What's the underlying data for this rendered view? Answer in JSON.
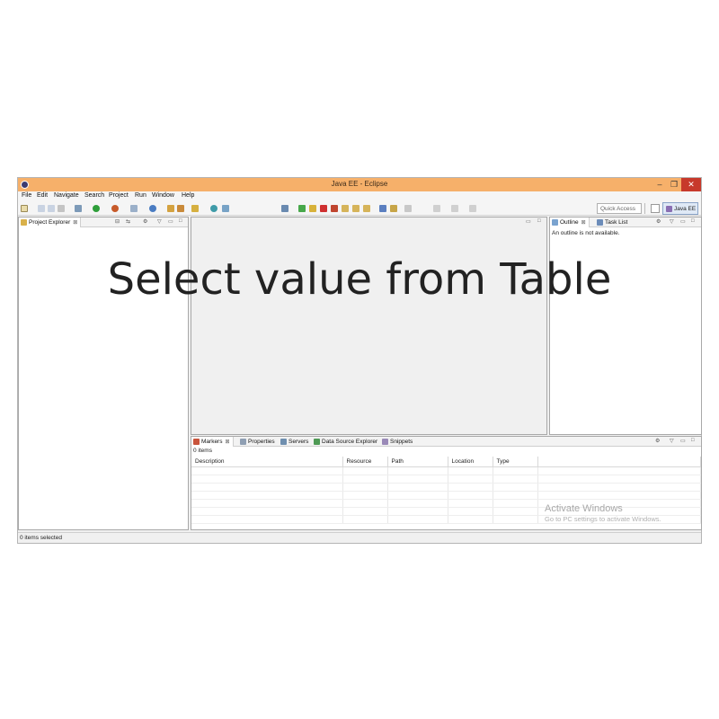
{
  "window": {
    "title": "Java EE - Eclipse",
    "min": "–",
    "max": "❐",
    "close": "✕"
  },
  "menu": [
    "File",
    "Edit",
    "Navigate",
    "Search",
    "Project",
    "Run",
    "Window",
    "Help"
  ],
  "toolbar": {
    "quick_access_placeholder": "Quick Access",
    "perspective": "Java EE"
  },
  "project_explorer": {
    "tab": "Project Explorer",
    "tab_close": "⊠"
  },
  "outline": {
    "tab": "Outline",
    "tab_close": "⊠",
    "task_tab": "Task List",
    "message": "An outline is not available."
  },
  "bottom": {
    "tabs": [
      "Markers",
      "Properties",
      "Servers",
      "Data Source Explorer",
      "Snippets"
    ],
    "tab_close": "⊠",
    "count": "0 items",
    "columns": [
      "Description",
      "Resource",
      "Path",
      "Location",
      "Type"
    ]
  },
  "status": {
    "text": "0 items selected"
  },
  "watermark": {
    "line1": "Activate Windows",
    "line2": "Go to PC settings to activate Windows."
  },
  "overlay": {
    "caption": "Select value from Table"
  },
  "colors": {
    "titlebar": "#f6b06a",
    "close": "#c7392b",
    "perspective_bg": "#dfe9f6"
  }
}
